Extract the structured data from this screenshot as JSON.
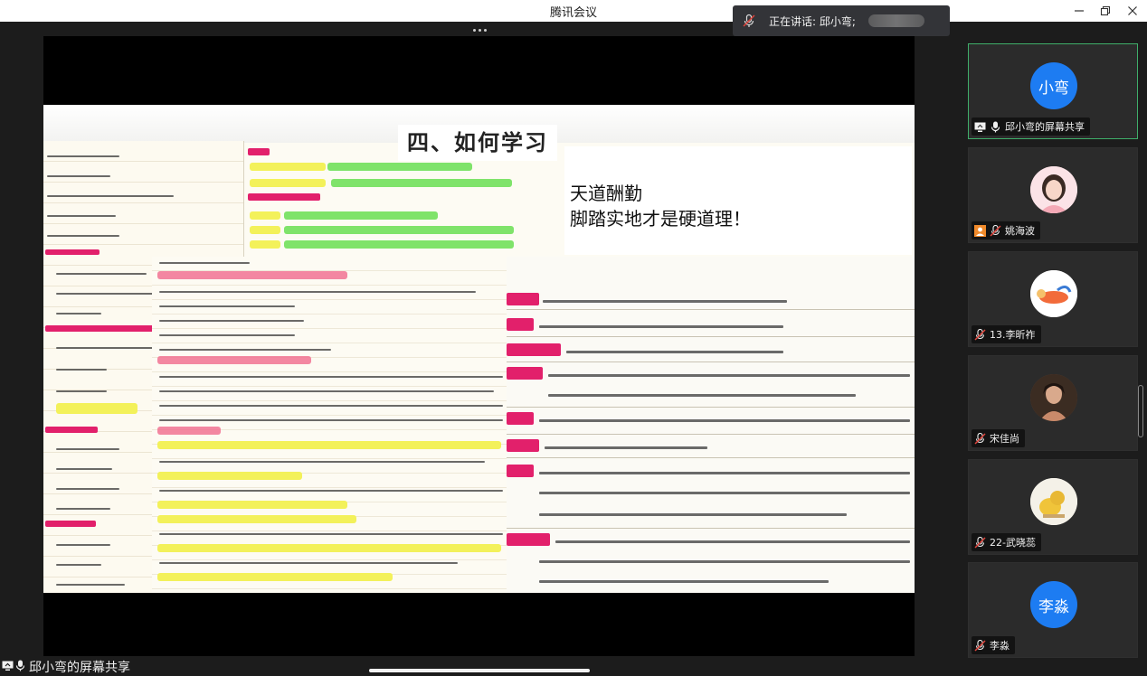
{
  "window": {
    "title": "腾讯会议"
  },
  "speaking": {
    "label": "正在讲话: 邱小弯;"
  },
  "slide": {
    "heading": "四、如何学习",
    "quote_line1": "天道酬勤",
    "quote_line2": "脚踏实地才是硬道理！"
  },
  "bottom_bar": {
    "share_label": "邱小弯的屏幕共享"
  },
  "participants": [
    {
      "avatar_text": "小弯",
      "name": "邱小弯的屏幕共享",
      "avatar_color": "#1d7cf2",
      "muted": false,
      "sharing": true,
      "active": true
    },
    {
      "avatar_text": "",
      "name": "姚海波",
      "avatar_color": "#f7c8cf",
      "muted": true,
      "sharing": false,
      "active": false
    },
    {
      "avatar_text": "",
      "name": "13.李昕祚",
      "avatar_color": "#ffffff",
      "muted": true,
      "sharing": false,
      "active": false
    },
    {
      "avatar_text": "",
      "name": "宋佳尚",
      "avatar_color": "#6b4a3a",
      "muted": true,
      "sharing": false,
      "active": false
    },
    {
      "avatar_text": "",
      "name": "22-武晓蕊",
      "avatar_color": "#f3f3ee",
      "muted": true,
      "sharing": false,
      "active": false
    },
    {
      "avatar_text": "李淼",
      "name": "李淼",
      "avatar_color": "#1d7cf2",
      "muted": true,
      "sharing": false,
      "active": false
    }
  ],
  "colors": {
    "active_border": "#3fae6a",
    "highlight_yellow": "#f3f15a",
    "highlight_green": "#7fe36a",
    "highlight_pink": "#f06a8c"
  }
}
